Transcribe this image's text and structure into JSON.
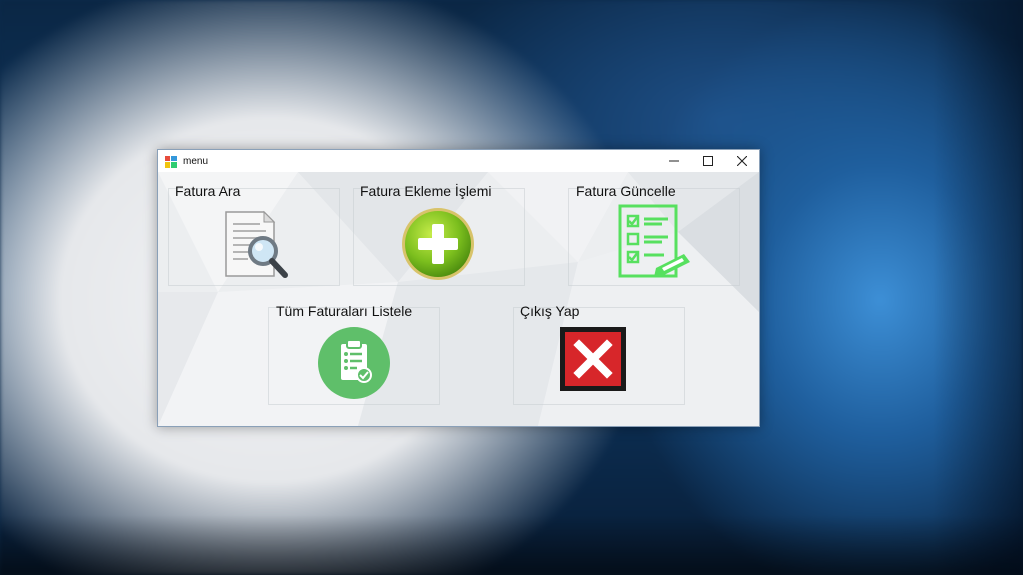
{
  "window": {
    "title": "menu",
    "controls": {
      "minimize_icon": "minimize-icon",
      "maximize_icon": "maximize-icon",
      "close_icon": "close-icon"
    }
  },
  "menu": {
    "search_invoice": {
      "label": "Fatura Ara",
      "icon": "magnifier-document-icon"
    },
    "add_invoice": {
      "label": "Fatura Ekleme İşlemi",
      "icon": "green-plus-circle-icon"
    },
    "update_invoice": {
      "label": "Fatura Güncelle",
      "icon": "checklist-pencil-icon"
    },
    "list_invoices": {
      "label": "Tüm Faturaları Listele",
      "icon": "clipboard-check-icon"
    },
    "exit": {
      "label": "Çıkış Yap",
      "icon": "red-x-icon"
    }
  },
  "colors": {
    "accent_green": "#7cbf1e",
    "list_green": "#5fbf6a",
    "update_green": "#57e05f",
    "exit_red": "#d7262a"
  }
}
